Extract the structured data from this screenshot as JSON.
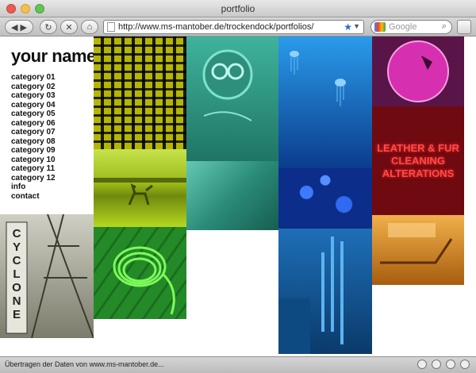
{
  "window": {
    "title": "portfolio"
  },
  "toolbar": {
    "url": "http://www.ms-mantober.de/trockendock/portfolios/",
    "search_placeholder": "Google"
  },
  "site": {
    "name": "your name",
    "nav": [
      "category 01",
      "category 02",
      "category 03",
      "category 04",
      "category 05",
      "category 06",
      "category 07",
      "category 08",
      "category 09",
      "category 10",
      "category 11",
      "category 12",
      "info",
      "contact"
    ]
  },
  "tiles": {
    "neon_sign": "LEATHER & FUR CLEANING ALTERATIONS",
    "cyclone": "CYCLONE"
  },
  "status": {
    "text": "Übertragen der Daten von www.ms-mantober.de..."
  },
  "colors": {
    "yellow": "#d7d72a",
    "lime": "#b6d81f",
    "teal": "#2f9b86",
    "blue": "#1b6fd1",
    "magenta": "#c726a6",
    "red": "#c8141d",
    "green": "#2fa032",
    "orange": "#d9891e"
  }
}
